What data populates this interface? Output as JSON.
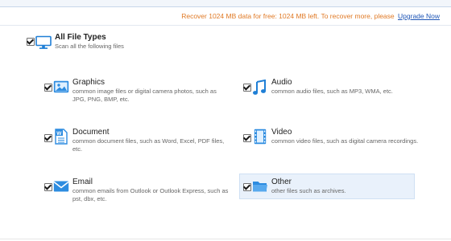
{
  "banner": {
    "text": "Recover 1024 MB data for free: 1024 MB left. To recover more, please",
    "link": "Upgrade Now"
  },
  "all_types": {
    "title": "All File Types",
    "desc": "Scan all the following files"
  },
  "categories": {
    "graphics": {
      "title": "Graphics",
      "desc": "common image files or digital camera photos, such as JPG, PNG, BMP, etc."
    },
    "audio": {
      "title": "Audio",
      "desc": "common audio files, such as MP3, WMA, etc."
    },
    "document": {
      "title": "Document",
      "desc": "common document files, such as Word, Excel, PDF files, etc."
    },
    "video": {
      "title": "Video",
      "desc": "common video files, such as digital camera recordings."
    },
    "email": {
      "title": "Email",
      "desc": "common emails from Outlook or Outlook Express, such as pst, dbx, etc."
    },
    "other": {
      "title": "Other",
      "desc": "other files such as archives."
    }
  },
  "icons": {
    "all_types": "monitor-icon",
    "graphics": "image-icon",
    "audio": "music-note-icon",
    "document": "word-document-icon",
    "video": "film-icon",
    "email": "envelope-icon",
    "other": "folder-icon"
  },
  "colors": {
    "accent": "#1f7fd6",
    "banner_text": "#e07a26",
    "link": "#1f56b6",
    "highlight": "#e9f1fb"
  }
}
